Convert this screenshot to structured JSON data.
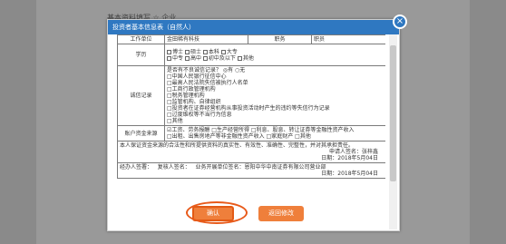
{
  "background": {
    "text": "基本资料填写 ☆ 企业"
  },
  "modal": {
    "title": "投资者基本信息表（自然人）",
    "close_glyph": "×"
  },
  "table": {
    "header_row": {
      "c1": "工作单位",
      "c2": "金田稀有科技",
      "c3": "职务",
      "c4": "职员"
    },
    "education": {
      "label": "学历",
      "line1": [
        {
          "text": "博士",
          "checked": false
        },
        {
          "text": "硕士",
          "checked": false
        },
        {
          "text": "本科",
          "checked": false
        },
        {
          "text": "大专",
          "checked": false
        }
      ],
      "line2": [
        {
          "text": "中专",
          "checked": false
        },
        {
          "text": "高中",
          "checked": false
        },
        {
          "text": "初中及以下",
          "checked": false
        },
        {
          "text": "其他",
          "checked": false
        }
      ]
    },
    "integrity": {
      "label": "诚信记录",
      "lines": [
        "是否有不良诚信记录？ ◎有 ○无",
        "□中国人民银行征信中心",
        "□最高人民法院失信被执行人名单",
        "□工商行政管理机构",
        "□税务管理机构",
        "□监管机构、自律组织",
        "□投资者在证券经营机构从事投资活动时产生的违约等失信行为记录",
        "□过度维权等不当行为信息",
        "□其他"
      ]
    },
    "fund_source": {
      "label": "账户资金来源",
      "lines": [
        "☑工资、劳务报酬 □生产经营所得 □利息、股息、转让证券等金融性资产收入",
        "□出租、出售房地产等非金融性资产收入 □家庭财产 □其他"
      ]
    },
    "declaration": {
      "text": "本人保证资金来源的合法性和所提供资料的真实性、有效性、准确性、完整性，并对其承担责任。",
      "sign_label": "申请人签名：张梓鑫",
      "date_label": "日期：",
      "date_value": "2018年5月04日"
    },
    "footer_row": {
      "handler_label": "经办人签署：",
      "reviewer_label": "复核人签名：",
      "dept_label": "业务开展单位签名：",
      "dept_value": "恩阳中华中南证券有限公司营业部",
      "date_label": "日期：",
      "date_value": "2018年5月04日"
    }
  },
  "buttons": {
    "confirm": "确认",
    "modify": "返回修改"
  },
  "colors": {
    "header": "#2f78c1",
    "button": "#ef7f3b",
    "highlight": "#e85a1a"
  }
}
